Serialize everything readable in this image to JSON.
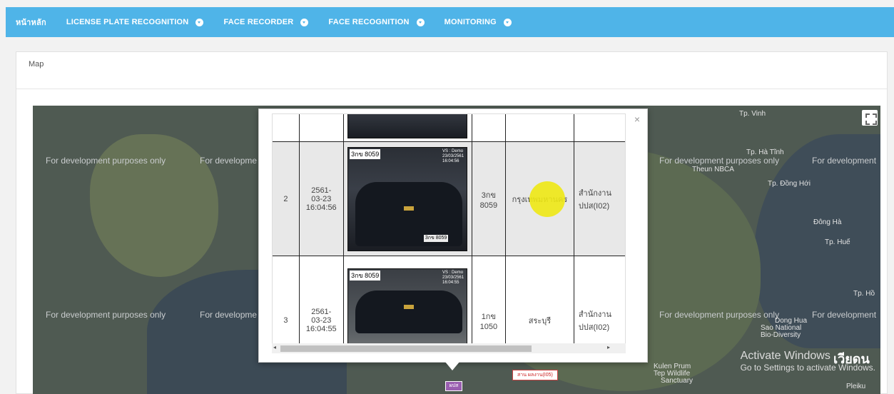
{
  "nav": {
    "home": "หน้าหลัก",
    "items": [
      {
        "label": "LICENSE PLATE RECOGNITION"
      },
      {
        "label": "FACE RECORDER"
      },
      {
        "label": "FACE RECOGNITION"
      },
      {
        "label": "MONITORING"
      }
    ]
  },
  "panel": {
    "title": "Map"
  },
  "map": {
    "watermark": "For development purposes only",
    "watermark_cut": "For developme",
    "watermark_cut2": "For development",
    "labels": {
      "tp_vinh": "Tp. Vinh",
      "tp_ha_tinh": "Tp. Hà Tĩnh",
      "theun_nbca": "Theun NBCA",
      "tp_dong_hoi": "Tp. Đồng Hới",
      "dong_ha": "Đông Hà",
      "tp_hue": "Tp. Huế",
      "tp_ho": "Tp. Hồ",
      "song_hua": "Dong Hua",
      "sao_national": "Sao National",
      "bio_diversity": "Bio-Diversity",
      "kulen": "Kulen Prum",
      "tep_wildlife": "Tep Wildlife",
      "sanctuary": "Sanctuary",
      "pleiku": "Pleiku",
      "vietnam": "เวียดน"
    },
    "activate_title": "Activate Windows",
    "activate_sub": "Go to Settings to activate Windows.",
    "marker_label": "ผปส",
    "red_label": "สาน ผลงาน(I05)"
  },
  "popup": {
    "rows": [
      {
        "index": "2",
        "datetime": "2561-\n03-23\n16:04:56",
        "plate_overlay": "3กข 8059",
        "stamp": "VS : Demo\n23/03/2561\n16:04:56",
        "plate": "3กข\n8059",
        "province": "กรุงเทพมหานคร",
        "office": "สำนักงาน\nปปส(I02)"
      },
      {
        "index": "3",
        "datetime": "2561-\n03-23\n16:04:55",
        "plate_overlay": "3กข 8059",
        "stamp": "VS : Demo\n23/03/2561\n16:04:55",
        "plate": "1กข\n1050",
        "province": "สระบุรี",
        "office": "สำนักงาน\nปปส(I02)"
      }
    ],
    "close": "×"
  },
  "colors": {
    "nav_bg": "#4fb4e8",
    "map_bg": "#4f5a52"
  }
}
